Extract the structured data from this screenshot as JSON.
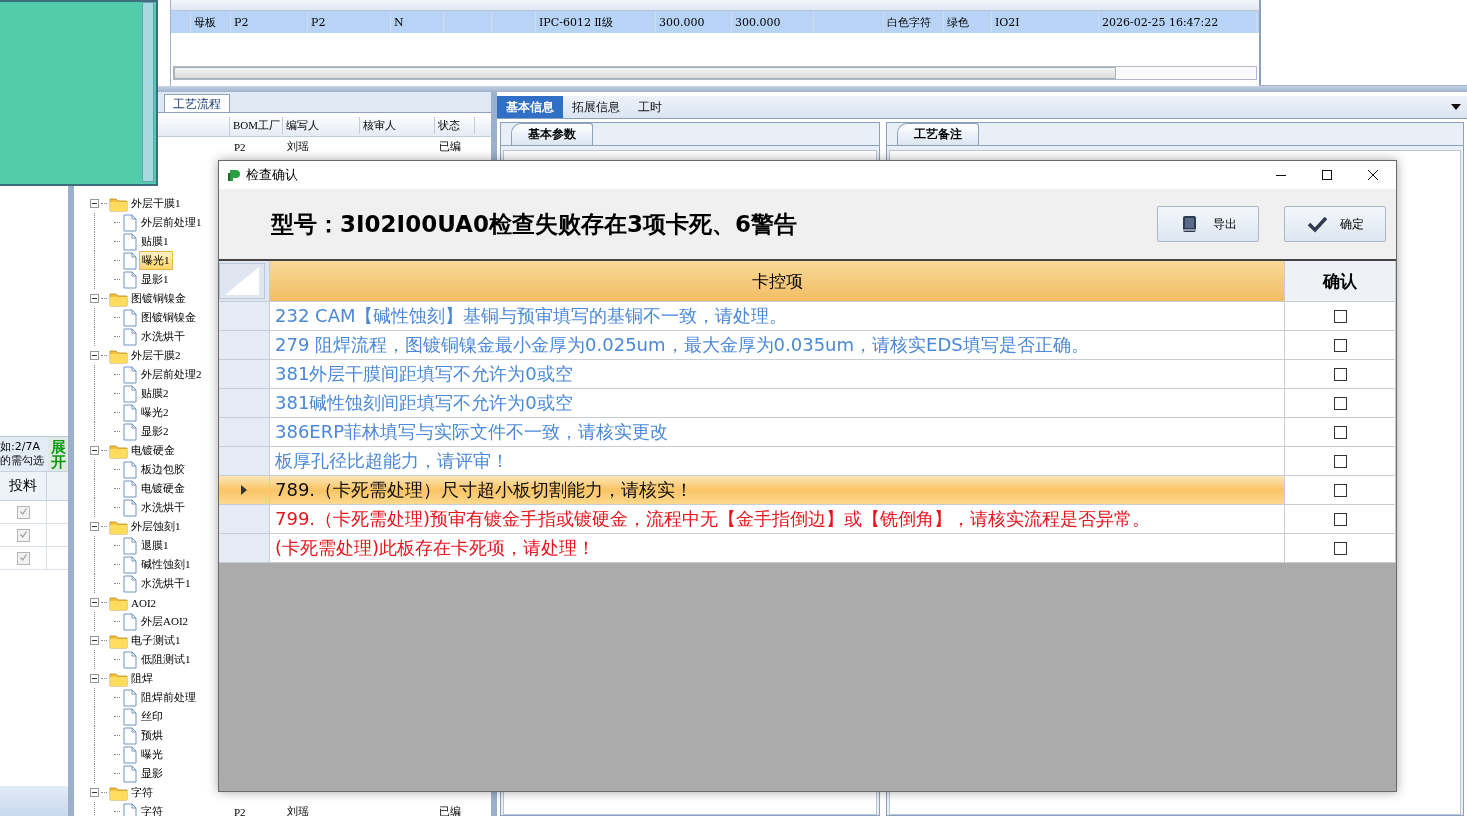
{
  "top_grid": {
    "rows": [
      {
        "selected": true,
        "cells": [
          "",
          "母板",
          "P2",
          "P2",
          "N",
          "",
          "",
          "IPC-6012 Ⅱ级",
          "300.000",
          "300.000",
          "",
          "白色字符",
          "绿色",
          "IO2I",
          "2026-02-25 16:47:22"
        ]
      }
    ]
  },
  "left_panel": {
    "hint_lines": [
      "如:2/7A",
      "的需勾选"
    ],
    "expand_button": "展开",
    "column": "投料",
    "rows": [
      {
        "checked": true
      },
      {
        "checked": true
      },
      {
        "checked": true
      }
    ]
  },
  "process_panel": {
    "tab": "工艺流程",
    "columns": [
      "BOM工厂",
      "编写人",
      "核审人",
      "状态"
    ],
    "top_row": {
      "cells": [
        "P2",
        "刘瑶",
        "",
        "已编"
      ]
    },
    "tree": [
      {
        "label": "外层干膜1",
        "expanded": true,
        "selected": false,
        "children": [
          {
            "label": "外层前处理1",
            "selected": false
          },
          {
            "label": "贴膜1",
            "selected": false
          },
          {
            "label": "曝光1",
            "selected": true
          },
          {
            "label": "显影1",
            "selected": false
          }
        ]
      },
      {
        "label": "图镀铜镍金",
        "expanded": true,
        "selected": false,
        "children": [
          {
            "label": "图镀铜镍金",
            "selected": false
          },
          {
            "label": "水洗烘干",
            "selected": false
          }
        ]
      },
      {
        "label": "外层干膜2",
        "expanded": true,
        "selected": false,
        "children": [
          {
            "label": "外层前处理2",
            "selected": false
          },
          {
            "label": "贴膜2",
            "selected": false
          },
          {
            "label": "曝光2",
            "selected": false
          },
          {
            "label": "显影2",
            "selected": false
          }
        ]
      },
      {
        "label": "电镀硬金",
        "expanded": true,
        "selected": false,
        "children": [
          {
            "label": "板边包胶",
            "selected": false
          },
          {
            "label": "电镀硬金",
            "selected": false
          },
          {
            "label": "水洗烘干",
            "selected": false
          }
        ]
      },
      {
        "label": "外层蚀刻1",
        "expanded": true,
        "selected": false,
        "children": [
          {
            "label": "退膜1",
            "selected": false
          },
          {
            "label": "碱性蚀刻1",
            "selected": false
          },
          {
            "label": "水洗烘干1",
            "selected": false
          }
        ]
      },
      {
        "label": "AOI2",
        "expanded": true,
        "selected": false,
        "children": [
          {
            "label": "外层AOI2",
            "selected": false
          }
        ]
      },
      {
        "label": "电子测试1",
        "expanded": true,
        "selected": false,
        "children": [
          {
            "label": "低阻测试1",
            "selected": false
          }
        ]
      },
      {
        "label": "阻焊",
        "expanded": true,
        "selected": false,
        "children": [
          {
            "label": "阻焊前处理",
            "selected": false
          },
          {
            "label": "丝印",
            "selected": false
          },
          {
            "label": "预烘",
            "selected": false
          },
          {
            "label": "曝光",
            "selected": false
          },
          {
            "label": "显影",
            "selected": false
          }
        ]
      },
      {
        "label": "字符",
        "expanded": true,
        "selected": false,
        "children": [
          {
            "label": "字符",
            "selected": false,
            "cells": [
              "P2",
              "刘瑶",
              "",
              "已编"
            ]
          }
        ]
      }
    ]
  },
  "info_panel": {
    "tabs": [
      {
        "label": "基本信息",
        "selected": true
      },
      {
        "label": "拓展信息",
        "selected": false
      },
      {
        "label": "工时",
        "selected": false
      }
    ],
    "left_tab": "基本参数",
    "right_tab": "工艺备注"
  },
  "dialog": {
    "title": "检查确认",
    "heading": "型号：3I02I00UA0检查失败存在3项卡死、6警告",
    "buttons": [
      {
        "label": "导出",
        "kind": "export"
      },
      {
        "label": "确定",
        "kind": "confirm"
      }
    ],
    "columns": [
      "卡控项",
      "确认"
    ],
    "rows": [
      {
        "text": "232 CAM【碱性蚀刻】基铜与预审填写的基铜不一致，请处理。",
        "color": "#4a88d8",
        "selected": false,
        "checked": false
      },
      {
        "text": "279 阻焊流程，图镀铜镍金最小金厚为0.025um，最大金厚为0.035um，请核实EDS填写是否正确。",
        "color": "#4a88d8",
        "selected": false,
        "checked": false
      },
      {
        "text": "381外层干膜间距填写不允许为0或空",
        "color": "#4a88d8",
        "selected": false,
        "checked": false
      },
      {
        "text": "381碱性蚀刻间距填写不允许为0或空",
        "color": "#4a88d8",
        "selected": false,
        "checked": false
      },
      {
        "text": "386ERP菲林填写与实际文件不一致，请核实更改",
        "color": "#4a88d8",
        "selected": false,
        "checked": false
      },
      {
        "text": "板厚孔径比超能力，请评审！",
        "color": "#4a88d8",
        "selected": false,
        "checked": false
      },
      {
        "text": "789.（卡死需处理）尺寸超小板切割能力，请核实！",
        "color": "#101010",
        "selected": true,
        "checked": false
      },
      {
        "text": "799.（卡死需处理)预审有镀金手指或镀硬金，流程中无【金手指倒边】或【铣倒角】，请核实流程是否异常。",
        "color": "#e8141c",
        "selected": false,
        "checked": false
      },
      {
        "text": "(卡死需处理)此板存在卡死项，请处理！",
        "color": "#e8141c",
        "selected": false,
        "checked": false
      }
    ]
  }
}
